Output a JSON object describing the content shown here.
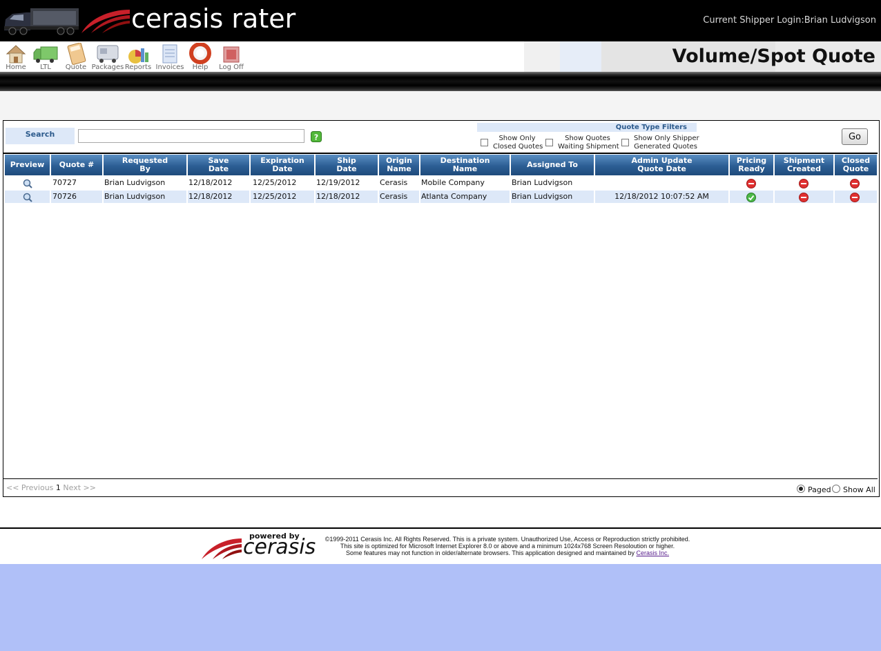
{
  "header": {
    "logo_text": "cerasis rater",
    "login_info": "Current Shipper Login:Brian Ludvigson",
    "page_title": "Volume/Spot Quote"
  },
  "nav": {
    "items": [
      {
        "label": "Home",
        "icon": "home-icon"
      },
      {
        "label": "LTL",
        "icon": "truck-icon"
      },
      {
        "label": "Quote",
        "icon": "calculator-icon"
      },
      {
        "label": "Packages",
        "icon": "packages-truck-icon"
      },
      {
        "label": "Reports",
        "icon": "reports-chart-icon"
      },
      {
        "label": "Invoices",
        "icon": "invoices-icon"
      },
      {
        "label": "Help",
        "icon": "lifebuoy-icon"
      },
      {
        "label": "Log Off",
        "icon": "log-off-icon"
      }
    ]
  },
  "search": {
    "label": "Search",
    "value": "",
    "placeholder": ""
  },
  "filters": {
    "title": "Quote Type Filters",
    "options": [
      {
        "line1": "Show Only",
        "line2": "Closed Quotes",
        "checked": false
      },
      {
        "line1": "Show Quotes",
        "line2": "Waiting Shipment",
        "checked": false
      },
      {
        "line1": "Show Only Shipper",
        "line2": "Generated Quotes",
        "checked": false
      }
    ],
    "go_label": "Go"
  },
  "table": {
    "columns": [
      {
        "line1": "Preview",
        "line2": ""
      },
      {
        "line1": "Quote #",
        "line2": ""
      },
      {
        "line1": "Requested",
        "line2": "By"
      },
      {
        "line1": "Save",
        "line2": "Date"
      },
      {
        "line1": "Expiration",
        "line2": "Date"
      },
      {
        "line1": "Ship",
        "line2": "Date"
      },
      {
        "line1": "Origin",
        "line2": "Name"
      },
      {
        "line1": "Destination",
        "line2": "Name"
      },
      {
        "line1": "Assigned To",
        "line2": ""
      },
      {
        "line1": "Admin Update",
        "line2": "Quote Date"
      },
      {
        "line1": "Pricing",
        "line2": "Ready"
      },
      {
        "line1": "Shipment",
        "line2": "Created"
      },
      {
        "line1": "Closed",
        "line2": "Quote"
      }
    ],
    "rows": [
      {
        "quote": "70727",
        "requested_by": "Brian Ludvigson",
        "save_date": "12/18/2012",
        "expiration_date": "12/25/2012",
        "ship_date": "12/19/2012",
        "origin": "Cerasis",
        "destination": "Mobile Company",
        "assigned_to": "Brian Ludvigson",
        "admin_update": "",
        "pricing_ready": "no",
        "shipment_created": "no",
        "closed_quote": "no"
      },
      {
        "quote": "70726",
        "requested_by": "Brian Ludvigson",
        "save_date": "12/18/2012",
        "expiration_date": "12/25/2012",
        "ship_date": "12/18/2012",
        "origin": "Cerasis",
        "destination": "Atlanta Company",
        "assigned_to": "Brian Ludvigson",
        "admin_update": "12/18/2012 10:07:52 AM",
        "pricing_ready": "yes",
        "shipment_created": "no",
        "closed_quote": "no"
      }
    ]
  },
  "pager": {
    "previous": "<< Previous",
    "current": "1",
    "next": "Next >>",
    "paged_label": "Paged",
    "show_all_label": "Show All",
    "selected": "Paged"
  },
  "footer": {
    "powered_by": "powered by",
    "brand": "cerasis",
    "line1": "©1999-2011 Cerasis Inc. All Rights Reserved. This is a private system. Unauthorized Use, Access or Reproduction strictly prohibited.",
    "line2": "This site is optimized for Microsoft Internet Explorer 8.0 or above and a minimum 1024x768 Screen Resoloution or higher.",
    "line3": "Some features may not function in older/alternate browsers. This application designed and maintained by",
    "link": "Cerasis Inc."
  },
  "colors": {
    "header_bg": "#000000",
    "table_header": "#2c5e94",
    "row_alt": "#dde8f8",
    "status_no": "#e03030",
    "status_yes": "#3aa83a",
    "bottom_fill": "#b0c0f8"
  }
}
